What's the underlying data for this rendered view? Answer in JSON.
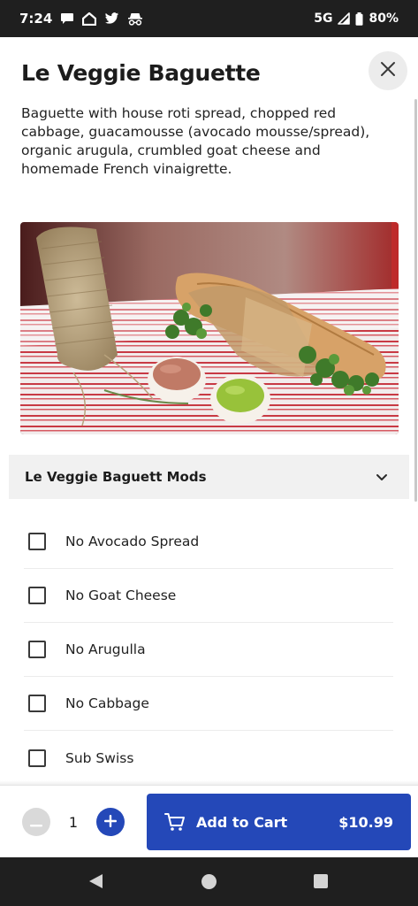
{
  "status_bar": {
    "time": "7:24",
    "network": "5G",
    "battery": "80%",
    "icons": [
      "chat-icon",
      "home-icon",
      "twitter-icon",
      "incognito-icon",
      "signal-icon",
      "battery-icon"
    ]
  },
  "item": {
    "title": "Le Veggie Baguette",
    "description": "Baguette with house roti spread, chopped red cabbage, guacamousse (avocado mousse/spread), organic arugula, crumbled goat cheese and homemade French vinaigrette.",
    "image_alt": "Le Veggie Baguette sandwich wrapped in paper with twine, with two dipping sauces on a striped cloth"
  },
  "mods": {
    "title": "Le Veggie Baguett Mods",
    "expanded": true,
    "options": [
      {
        "label": "No Avocado Spread",
        "checked": false
      },
      {
        "label": "No Goat Cheese",
        "checked": false
      },
      {
        "label": "No Arugulla",
        "checked": false
      },
      {
        "label": "No Cabbage",
        "checked": false
      },
      {
        "label": "Sub Swiss",
        "checked": false
      }
    ]
  },
  "cart": {
    "quantity": "1",
    "button_label": "Add to Cart",
    "price": "$10.99"
  },
  "colors": {
    "accent": "#2448b8",
    "status_bar_bg": "#1f1f1f",
    "section_bg": "#f1f1f1"
  }
}
